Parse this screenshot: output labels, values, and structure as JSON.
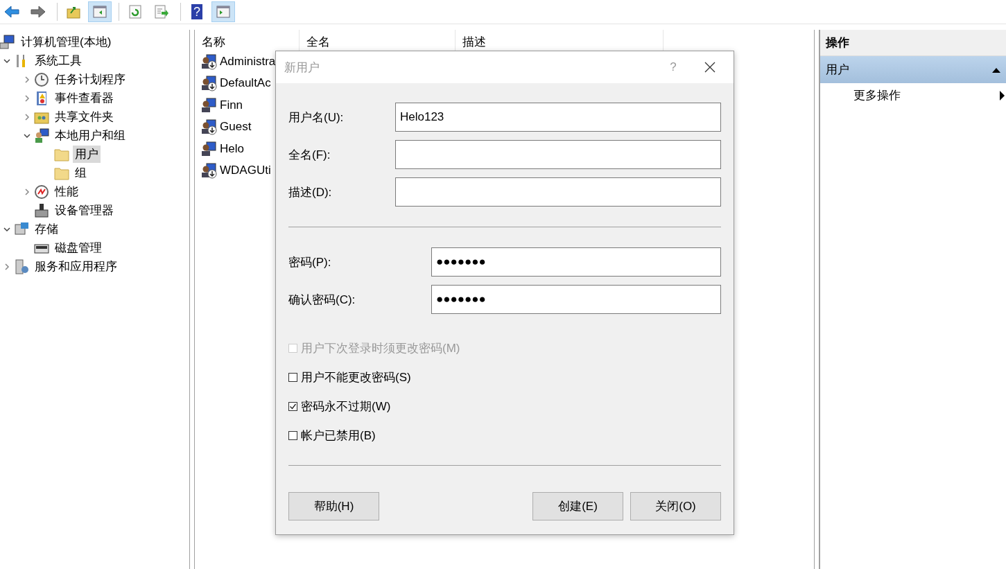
{
  "toolbar": {
    "buttons": [
      {
        "kind": "back",
        "pressed": false
      },
      {
        "kind": "forward",
        "pressed": false
      },
      {
        "kind": "up",
        "pressed": false
      },
      {
        "kind": "tree-toggle",
        "pressed": true
      },
      {
        "kind": "refresh",
        "pressed": false
      },
      {
        "kind": "export",
        "pressed": false
      },
      {
        "kind": "help",
        "pressed": false,
        "glyph": "?"
      },
      {
        "kind": "pane-toggle",
        "pressed": true
      }
    ]
  },
  "tree": [
    {
      "label": "计算机管理(本地)",
      "kind": "computer",
      "selected": false,
      "children": [
        {
          "label": "系统工具",
          "kind": "tools",
          "expanded": true,
          "selected": false,
          "children": [
            {
              "label": "任务计划程序",
              "kind": "clock",
              "expanded": false,
              "selected": false
            },
            {
              "label": "事件查看器",
              "kind": "log",
              "expanded": false,
              "selected": false
            },
            {
              "label": "共享文件夹",
              "kind": "share",
              "expanded": false,
              "selected": false
            },
            {
              "label": "本地用户和组",
              "kind": "users",
              "expanded": true,
              "selected": false,
              "children": [
                {
                  "label": "用户",
                  "kind": "folder",
                  "selected": true
                },
                {
                  "label": "组",
                  "kind": "folder",
                  "selected": false
                }
              ]
            },
            {
              "label": "性能",
              "kind": "gauge",
              "expanded": false,
              "selected": false
            },
            {
              "label": "设备管理器",
              "kind": "device",
              "selected": false
            }
          ]
        },
        {
          "label": "存储",
          "kind": "storage",
          "expanded": true,
          "selected": false,
          "children": [
            {
              "label": "磁盘管理",
              "kind": "disk",
              "selected": false
            }
          ]
        },
        {
          "label": "服务和应用程序",
          "kind": "services",
          "expanded": false,
          "selected": false
        }
      ]
    }
  ],
  "list": {
    "columns": [
      "名称",
      "全名",
      "描述"
    ],
    "rows": [
      {
        "name": "Administra",
        "disabled": true
      },
      {
        "name": "DefaultAc",
        "disabled": true
      },
      {
        "name": "Finn",
        "disabled": false
      },
      {
        "name": "Guest",
        "disabled": true
      },
      {
        "name": "Helo",
        "disabled": false
      },
      {
        "name": "WDAGUti",
        "disabled": true
      }
    ]
  },
  "actions": {
    "title": "操作",
    "section": {
      "label": "用户",
      "expanded": true
    },
    "items": [
      "更多操作"
    ]
  },
  "dialog": {
    "title": "新用户",
    "help_glyph": "?",
    "fields": [
      {
        "label": "用户名(U):",
        "value": "Helo123"
      },
      {
        "label": "全名(F):"
      },
      {
        "label": "描述(D):"
      }
    ],
    "password_fields": [
      {
        "label": "密码(P):",
        "value": "●●●●●●●"
      },
      {
        "label": "确认密码(C):",
        "value": "●●●●●●●"
      }
    ],
    "checkboxes": [
      {
        "label": "用户下次登录时须更改密码(M)",
        "checked": false,
        "disabled": true
      },
      {
        "label": "用户不能更改密码(S)",
        "checked": false,
        "disabled": false
      },
      {
        "label": "密码永不过期(W)",
        "checked": true,
        "disabled": false
      },
      {
        "label": "帐户已禁用(B)",
        "checked": false,
        "disabled": false
      }
    ],
    "help_button": "帮助(H)",
    "buttons": [
      "创建(E)",
      "关闭(O)"
    ]
  }
}
